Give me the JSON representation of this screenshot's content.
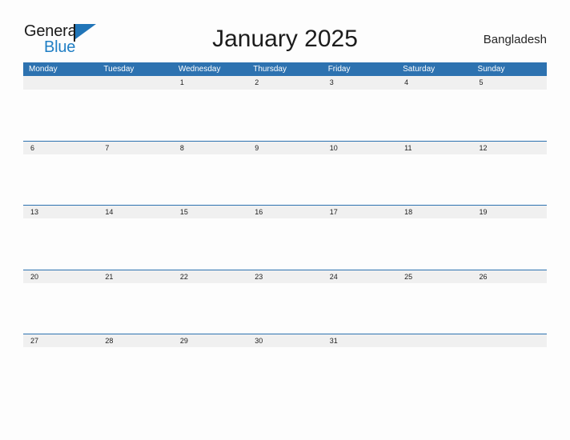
{
  "brand": {
    "name_part1": "General",
    "name_part2": "Blue",
    "flag_icon": "flag-icon",
    "accent_color": "#2175b8"
  },
  "header": {
    "title": "January 2025",
    "country": "Bangladesh"
  },
  "theme": {
    "header_blue": "#2d72b0",
    "band_gray": "#f0f0f0",
    "page_background": "#fdfdfd",
    "text_dark": "#1d1d1d",
    "text_white": "#ffffff"
  },
  "calendar": {
    "month": "January",
    "year": "2025",
    "weekdays": [
      "Monday",
      "Tuesday",
      "Wednesday",
      "Thursday",
      "Friday",
      "Saturday",
      "Sunday"
    ],
    "weeks": [
      {
        "days": [
          "",
          "",
          "1",
          "2",
          "3",
          "4",
          "5"
        ]
      },
      {
        "days": [
          "6",
          "7",
          "8",
          "9",
          "10",
          "11",
          "12"
        ]
      },
      {
        "days": [
          "13",
          "14",
          "15",
          "16",
          "17",
          "18",
          "19"
        ]
      },
      {
        "days": [
          "20",
          "21",
          "22",
          "23",
          "24",
          "25",
          "26"
        ]
      },
      {
        "days": [
          "27",
          "28",
          "29",
          "30",
          "31",
          "",
          ""
        ]
      }
    ]
  }
}
